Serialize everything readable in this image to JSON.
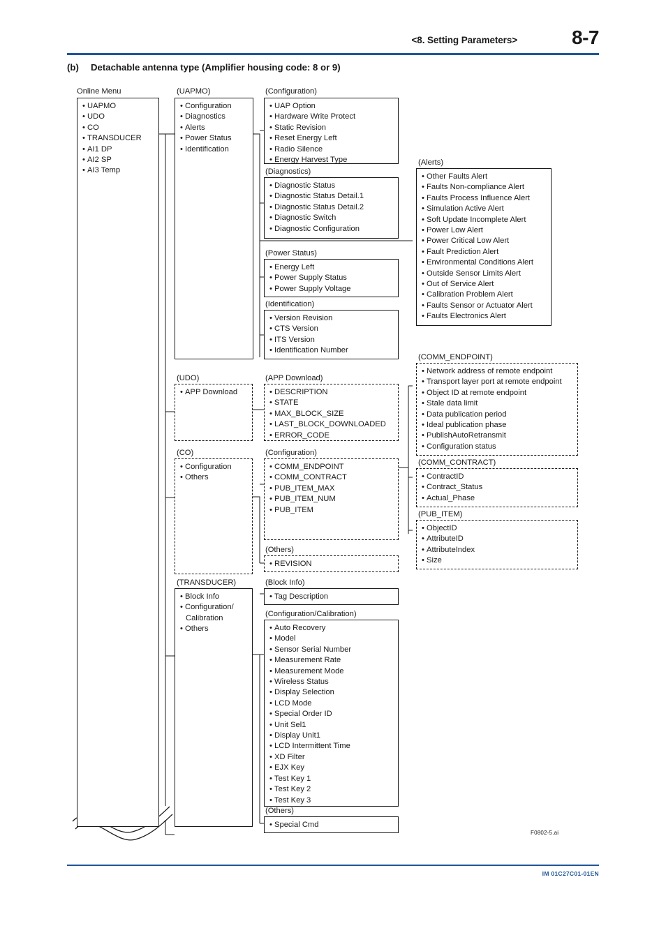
{
  "header": {
    "title": "<8.  Setting Parameters>",
    "page_number": "8-7"
  },
  "section": {
    "label": "(b)",
    "title": "Detachable antenna type (Amplifier housing code: 8 or 9)"
  },
  "footer": {
    "figure_code": "F0802-5.ai",
    "document_code": "IM 01C27C01-01EN"
  },
  "colors": {
    "rule": "#20559a",
    "text": "#1a1a1a",
    "line": "#1a1a1a"
  },
  "diagram": {
    "online_menu": {
      "caption": "Online Menu",
      "items": [
        "UAPMO",
        "UDO",
        "CO",
        "TRANSDUCER",
        "AI1 DP",
        "AI2 SP",
        "AI3 Temp"
      ]
    },
    "uapmo": {
      "caption": "(UAPMO)",
      "items": [
        "Configuration",
        "Diagnostics",
        "Alerts",
        "Power Status",
        "Identification"
      ]
    },
    "uapmo_configuration": {
      "caption": "(Configuration)",
      "items": [
        "UAP Option",
        "Hardware Write Protect",
        "Static Revision",
        "Reset Energy Left",
        "Radio Silence",
        "Energy Harvest Type"
      ]
    },
    "diagnostics": {
      "caption": "(Diagnostics)",
      "items": [
        "Diagnostic Status",
        "Diagnostic Status Detail.1",
        "Diagnostic Status Detail.2",
        "Diagnostic Switch",
        "Diagnostic Configuration"
      ]
    },
    "power_status": {
      "caption": "(Power Status)",
      "items": [
        "Energy Left",
        "Power Supply Status",
        "Power Supply Voltage"
      ]
    },
    "identification": {
      "caption": "(Identification)",
      "items": [
        "Version Revision",
        "CTS Version",
        "ITS Version",
        "Identification Number"
      ]
    },
    "alerts": {
      "caption": "(Alerts)",
      "items": [
        "Other Faults Alert",
        "Faults Non-compliance Alert",
        "Faults Process Influence Alert",
        "Simulation Active Alert",
        "Soft Update Incomplete Alert",
        "Power Low Alert",
        "Power Critical Low Alert",
        "Fault Prediction Alert",
        "Environmental Conditions Alert",
        "Outside Sensor Limits Alert",
        "Out of Service Alert",
        "Calibration Problem Alert",
        "Faults Sensor or Actuator Alert",
        "Faults Electronics Alert"
      ]
    },
    "udo": {
      "caption": "(UDO)",
      "items": [
        "APP Download"
      ]
    },
    "app_download": {
      "caption": "(APP Download)",
      "items": [
        "DESCRIPTION",
        "STATE",
        "MAX_BLOCK_SIZE",
        "LAST_BLOCK_DOWNLOADED",
        "ERROR_CODE"
      ]
    },
    "co": {
      "caption": "(CO)",
      "items": [
        "Configuration",
        "Others"
      ]
    },
    "co_configuration": {
      "caption": "(Configuration)",
      "items": [
        "COMM_ENDPOINT",
        "COMM_CONTRACT",
        "PUB_ITEM_MAX",
        "PUB_ITEM_NUM",
        "PUB_ITEM"
      ]
    },
    "co_others": {
      "caption": "(Others)",
      "items": [
        "REVISION"
      ]
    },
    "comm_endpoint": {
      "caption": "(COMM_ENDPOINT)",
      "items": [
        "Network address of remote endpoint",
        "Transport layer port at remote endpoint",
        "Object ID at remote endpoint",
        "Stale data limit",
        "Data publication period",
        "Ideal publication phase",
        "PublishAutoRetransmit",
        "Configuration status"
      ]
    },
    "comm_contract": {
      "caption": "(COMM_CONTRACT)",
      "items": [
        "ContractID",
        "Contract_Status",
        "Actual_Phase"
      ]
    },
    "pub_item": {
      "caption": "(PUB_ITEM)",
      "items": [
        "ObjectID",
        "AttributeID",
        "AttributeIndex",
        "Size"
      ]
    },
    "transducer": {
      "caption": "(TRANSDUCER)",
      "items": [
        "Block Info",
        "Configuration/",
        "Calibration",
        "Others"
      ]
    },
    "block_info": {
      "caption": "(Block Info)",
      "items": [
        "Tag Description"
      ]
    },
    "config_calibration": {
      "caption": "(Configuration/Calibration)",
      "items": [
        "Auto Recovery",
        "Model",
        "Sensor Serial Number",
        "Measurement Rate",
        "Measurement Mode",
        "Wireless Status",
        "Display Selection",
        "LCD Mode",
        "Special Order ID",
        "Unit Sel1",
        "Display Unit1",
        "LCD Intermittent Time",
        "XD Filter",
        "EJX Key",
        "Test Key 1",
        "Test Key 2",
        "Test Key 3"
      ]
    },
    "transducer_others": {
      "caption": "(Others)",
      "items": [
        "Special Cmd"
      ]
    }
  }
}
